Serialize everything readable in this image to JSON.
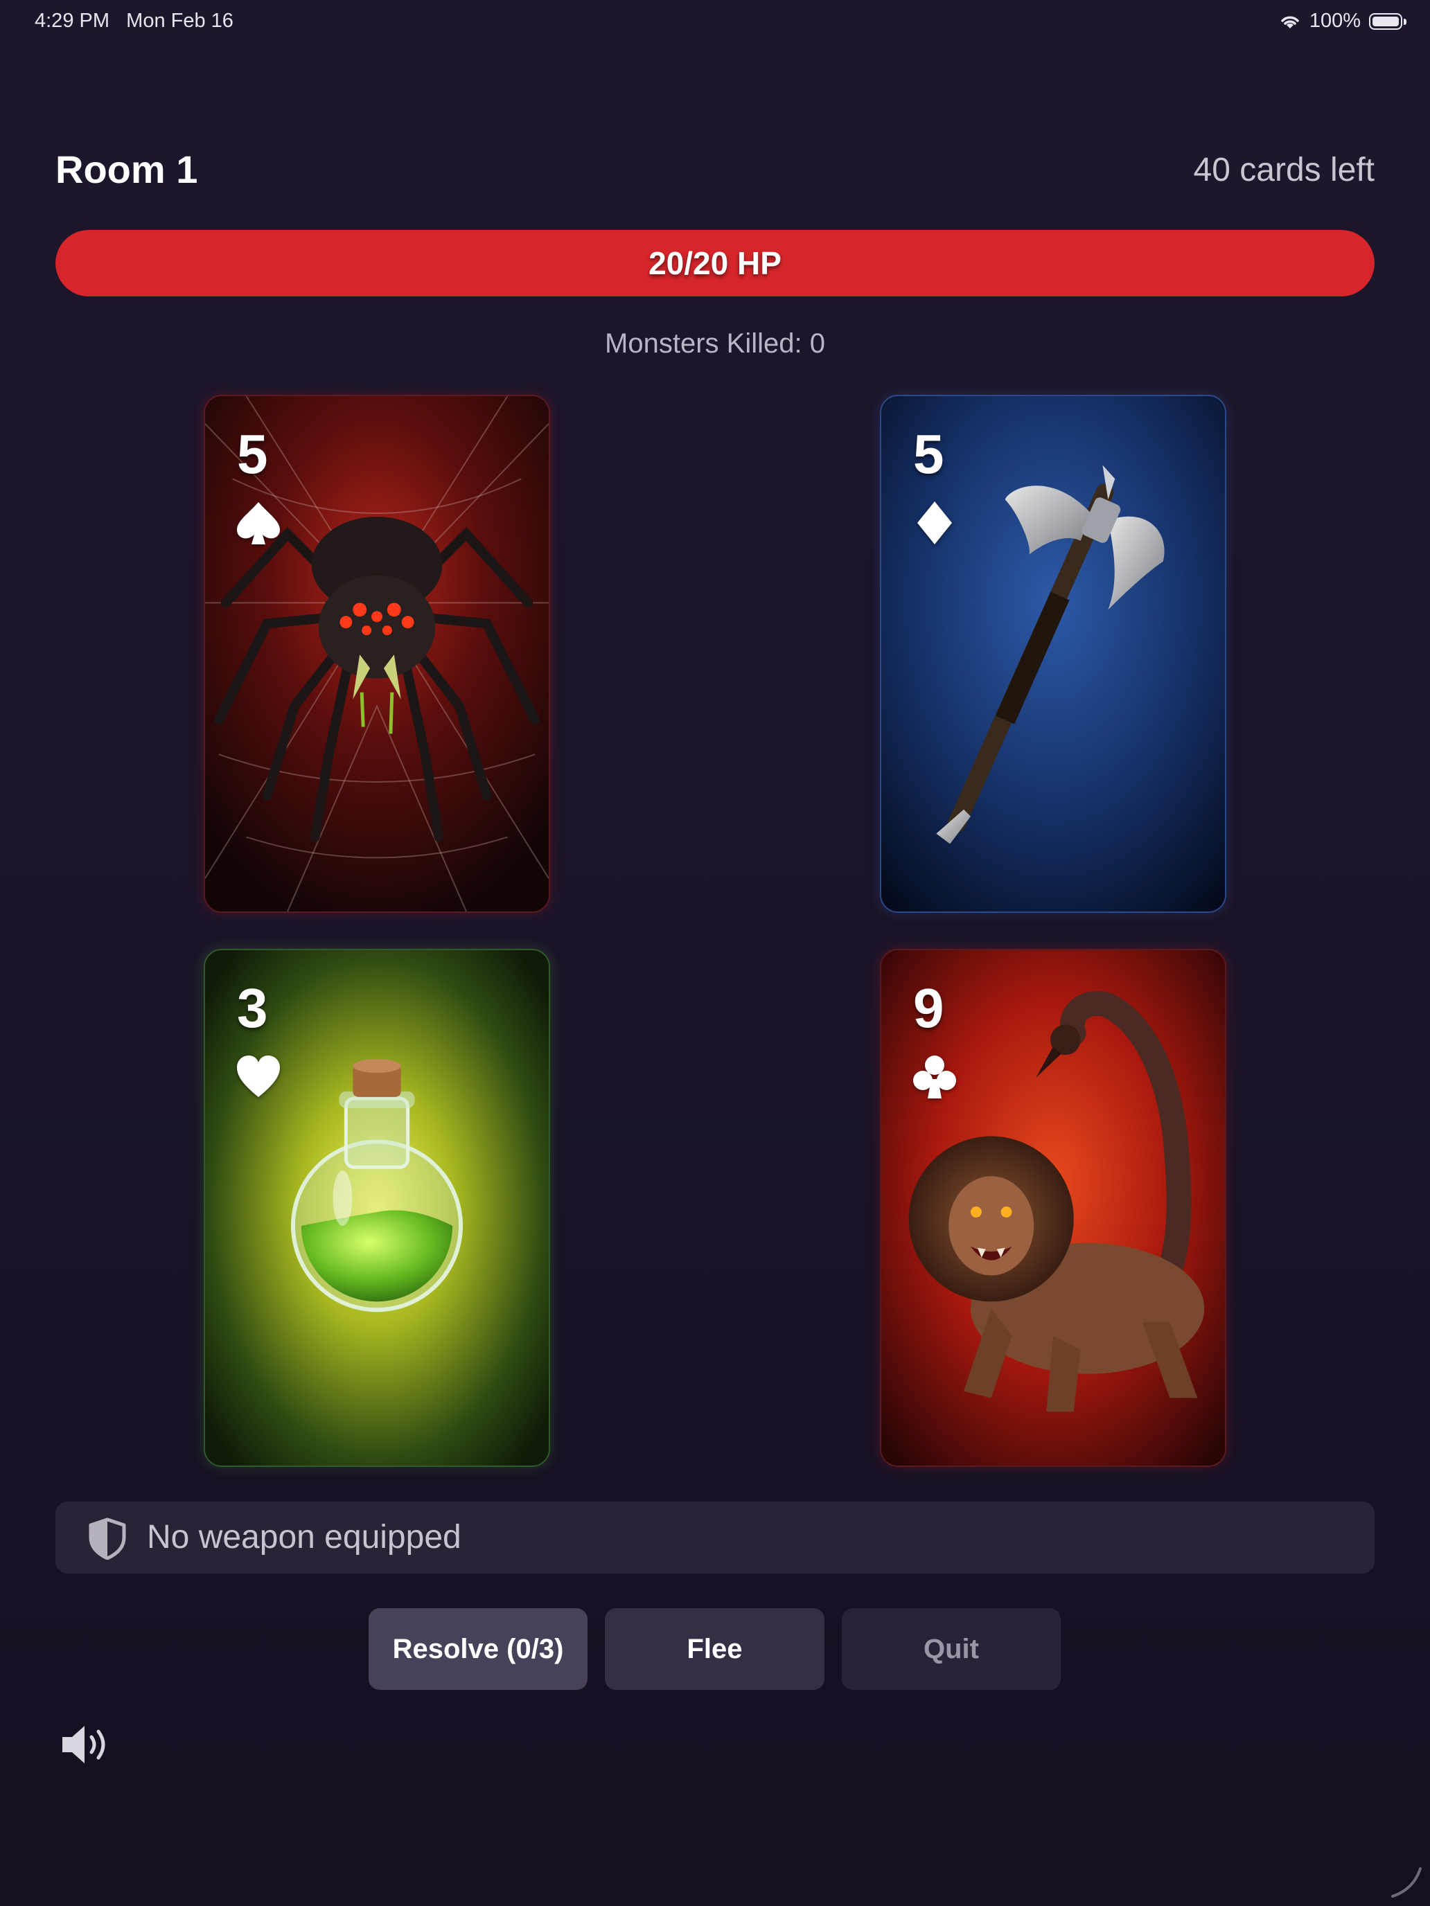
{
  "status_bar": {
    "time_date": "4:29 PM   Mon Feb 16",
    "battery_percent": "100%",
    "battery_level": 1.0
  },
  "header": {
    "room_title": "Room 1",
    "cards_left": "40 cards left"
  },
  "hp": {
    "label": "20/20 HP",
    "current": 20,
    "max": 20
  },
  "monsters_killed": "Monsters Killed: 0",
  "cards": [
    {
      "rank": "5",
      "suit": "spades",
      "art": "spider-monster"
    },
    {
      "rank": "5",
      "suit": "diamonds",
      "art": "battle-axe-weapon"
    },
    {
      "rank": "3",
      "suit": "hearts",
      "art": "health-potion"
    },
    {
      "rank": "9",
      "suit": "clubs",
      "art": "manticore-monster"
    }
  ],
  "weapon": {
    "status": "No weapon equipped",
    "icon": "shield-icon"
  },
  "actions": {
    "resolve": "Resolve (0/3)",
    "flee": "Flee",
    "quit": "Quit"
  },
  "icons": {
    "sound": "speaker-icon",
    "wifi": "wifi-icon",
    "battery": "battery-icon"
  },
  "colors": {
    "background": "#1c1528",
    "hp_bar": "#d7262b",
    "monster_border": "#5a1a1e",
    "weapon_border": "#2a4a8a",
    "potion_border": "#2f5a2a"
  }
}
